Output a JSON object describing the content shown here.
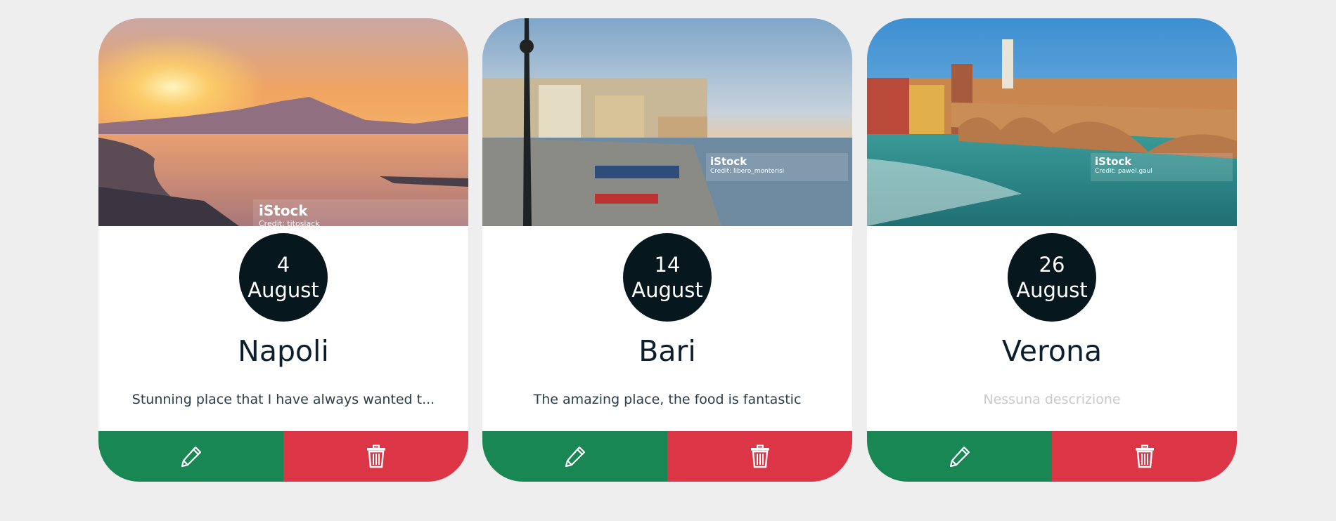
{
  "cards": [
    {
      "day": "4",
      "month": "August",
      "city": "Napoli",
      "description": "Stunning place that I have always wanted t...",
      "description_empty": false,
      "image_watermark": {
        "brand": "iStock",
        "credit": "Credit: titoslack"
      },
      "edit_icon": "pencil-icon",
      "delete_icon": "trash-icon"
    },
    {
      "day": "14",
      "month": "August",
      "city": "Bari",
      "description": "The amazing place, the food is fantastic",
      "description_empty": false,
      "image_watermark": {
        "brand": "iStock",
        "credit": "Credit: libero_monterisi"
      },
      "edit_icon": "pencil-icon",
      "delete_icon": "trash-icon"
    },
    {
      "day": "26",
      "month": "August",
      "city": "Verona",
      "description": "Nessuna descrizione",
      "description_empty": true,
      "image_watermark": {
        "brand": "iStock",
        "credit": "Credit: pawel.gaul"
      },
      "edit_icon": "pencil-icon",
      "delete_icon": "trash-icon"
    }
  ],
  "colors": {
    "background": "#eeeeee",
    "date_circle": "#07171e",
    "edit_button": "#198754",
    "delete_button": "#dc3545",
    "placeholder_text": "#c9c9c9"
  }
}
